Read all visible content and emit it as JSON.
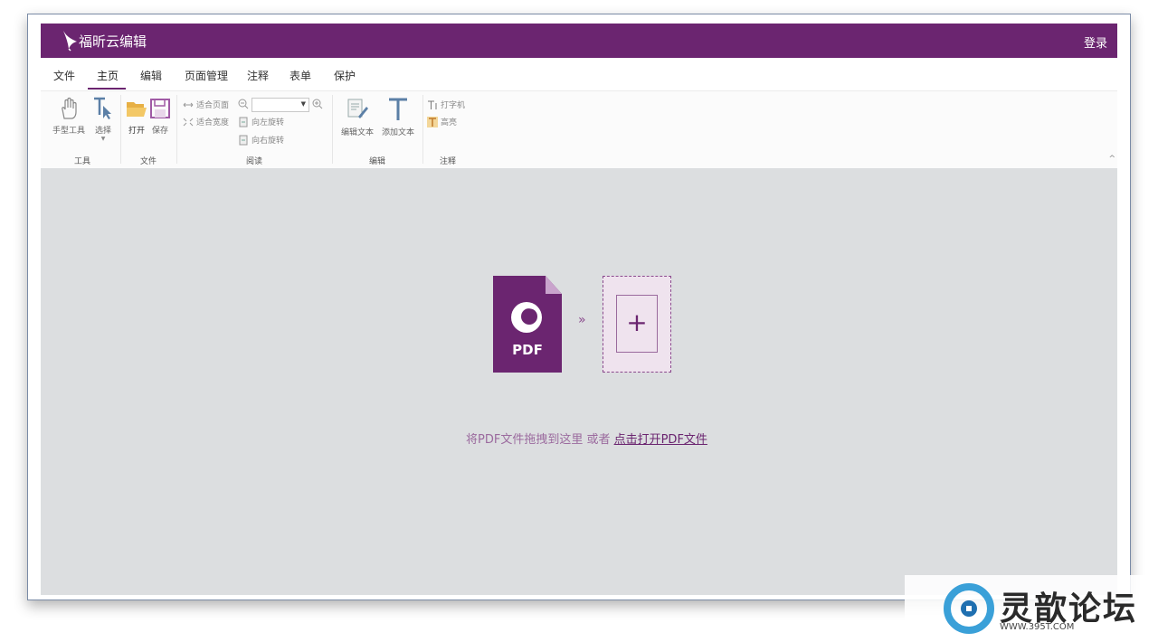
{
  "titlebar": {
    "app_title": "福昕云编辑",
    "login_label": "登录",
    "bg_color": "#6b2570"
  },
  "menu": {
    "tabs": [
      {
        "label": "文件"
      },
      {
        "label": "主页",
        "active": true
      },
      {
        "label": "编辑"
      },
      {
        "label": "页面管理"
      },
      {
        "label": "注释"
      },
      {
        "label": "表单"
      },
      {
        "label": "保护"
      }
    ]
  },
  "ribbon": {
    "tools": {
      "group_label": "工具",
      "hand_label": "手型工具",
      "select_label": "选择"
    },
    "file": {
      "group_label": "文件",
      "open_label": "打开",
      "save_label": "保存"
    },
    "read": {
      "group_label": "阅读",
      "fit_page_label": "适合页面",
      "fit_width_label": "适合宽度",
      "rotate_left_label": "向左旋转",
      "rotate_right_label": "向右旋转",
      "zoom_value": ""
    },
    "edit": {
      "group_label": "编辑",
      "edit_text_label": "编辑文本",
      "add_text_label": "添加文本"
    },
    "annot": {
      "group_label": "注释",
      "typewriter_label": "打字机",
      "highlight_label": "高亮"
    }
  },
  "workspace": {
    "pdf_icon_text": "PDF",
    "hint_prefix": "将PDF文件拖拽到这里 或者 ",
    "hint_link": "点击打开PDF文件",
    "accent": "#6b2570"
  },
  "watermark": {
    "brand": "灵歆论坛",
    "url": "WWW.395T.COM"
  }
}
